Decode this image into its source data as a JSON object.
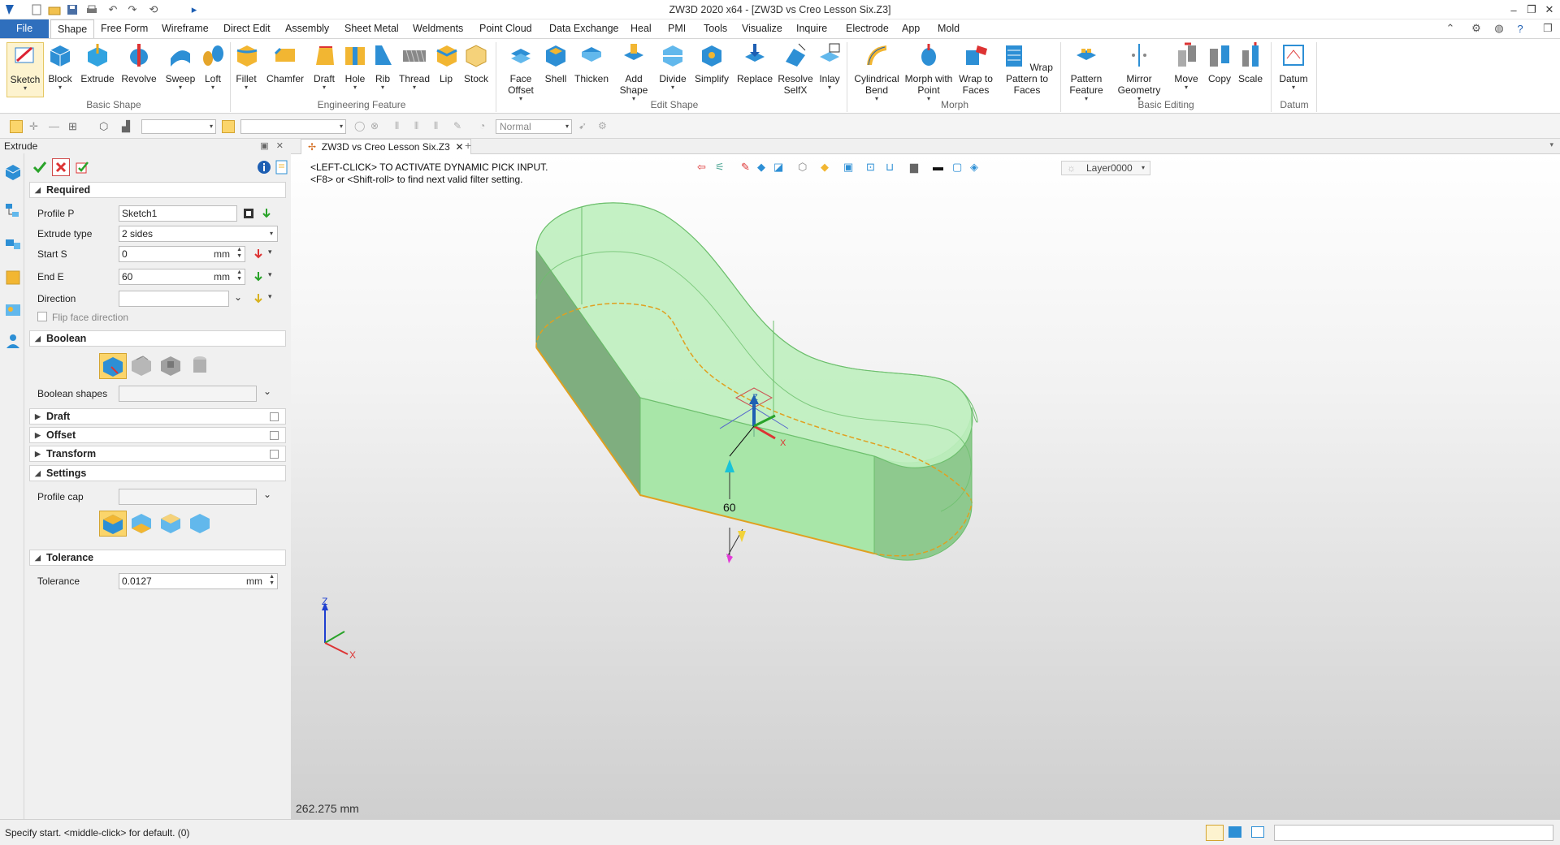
{
  "window": {
    "title": "ZW3D 2020 x64 - [ZW3D vs Creo Lesson Six.Z3]"
  },
  "menu": {
    "file": "File",
    "items": [
      "Shape",
      "Free Form",
      "Wireframe",
      "Direct Edit",
      "Assembly",
      "Sheet Metal",
      "Weldments",
      "Point Cloud",
      "Data Exchange",
      "Heal",
      "PMI",
      "Tools",
      "Visualize",
      "Inquire",
      "Electrode",
      "App",
      "Mold"
    ],
    "active": "Shape"
  },
  "ribbon": {
    "basic_shape": {
      "group": "Basic Shape",
      "buttons": [
        "Sketch",
        "Block",
        "Extrude",
        "Revolve",
        "Sweep",
        "Loft"
      ]
    },
    "engineering_feature": {
      "group": "Engineering Feature",
      "buttons": [
        "Fillet",
        "Chamfer",
        "Draft",
        "Hole",
        "Rib",
        "Thread",
        "Lip",
        "Stock"
      ]
    },
    "edit_shape": {
      "group": "Edit Shape",
      "buttons": [
        "Face Offset",
        "Shell",
        "Thicken",
        "Add Shape",
        "Divide",
        "Simplify",
        "Replace",
        "Resolve SelfX",
        "Inlay"
      ]
    },
    "morph": {
      "group": "Morph",
      "buttons": [
        "Cylindrical Bend",
        "Morph with Point",
        "Wrap to Faces",
        "Wrap Pattern to Faces"
      ]
    },
    "basic_editing": {
      "group": "Basic Editing",
      "buttons": [
        "Pattern Feature",
        "Mirror Geometry",
        "Move",
        "Copy",
        "Scale"
      ]
    },
    "datum": {
      "group": "Datum",
      "buttons": [
        "Datum"
      ]
    }
  },
  "filterbar": {
    "render_mode": "Normal"
  },
  "panel": {
    "title": "Extrude",
    "required": {
      "header": "Required",
      "profile_label": "Profile P",
      "profile_value": "Sketch1",
      "type_label": "Extrude type",
      "type_value": "2 sides",
      "start_label": "Start S",
      "start_value": "0",
      "start_unit": "mm",
      "end_label": "End E",
      "end_value": "60",
      "end_unit": "mm",
      "direction_label": "Direction",
      "direction_value": "",
      "flip_label": "Flip face direction"
    },
    "boolean": {
      "header": "Boolean",
      "shapes_label": "Boolean shapes"
    },
    "draft": "Draft",
    "offset": "Offset",
    "transform": "Transform",
    "settings": {
      "header": "Settings",
      "cap_label": "Profile cap"
    },
    "tolerance": {
      "header": "Tolerance",
      "label": "Tolerance",
      "value": "0.0127",
      "unit": "mm"
    }
  },
  "viewport": {
    "tab": "ZW3D vs Creo Lesson Six.Z3",
    "hint1": "<LEFT-CLICK> TO ACTIVATE DYNAMIC PICK INPUT.",
    "hint2": "<F8> or <Shift-roll> to find next valid filter setting.",
    "layer": "Layer0000",
    "dimension": "60",
    "readout": "262.275 mm",
    "triad_z": "Z",
    "triad_x": "X",
    "manip_z": "Z",
    "manip_x": "X"
  },
  "status": {
    "message": "Specify start.  <middle-click> for default. (0)"
  },
  "colors": {
    "accent": "#2f6fbd",
    "part_fill": "#9be39b",
    "selected_tool": "#fbd56b"
  }
}
